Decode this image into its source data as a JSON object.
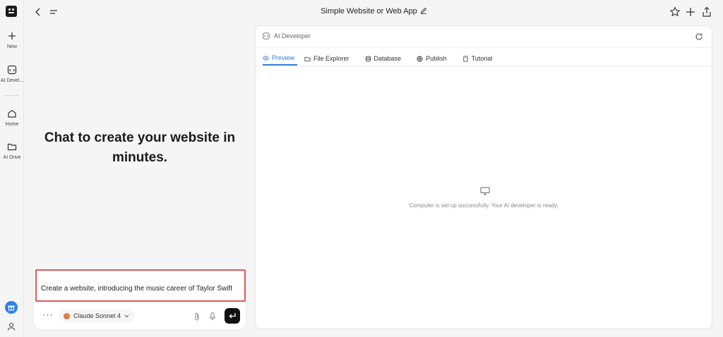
{
  "sidebar": {
    "new_label": "New",
    "ai_dev_label": "AI Devel...",
    "home_label": "Home",
    "drive_label": "AI Drive"
  },
  "header": {
    "title": "Simple Website or Web App"
  },
  "chat": {
    "hero": "Chat to create your website in minutes.",
    "prompt": "Create a website, introducing the music career of Taylor Swift",
    "more_label": "···",
    "model_label": "Claude Sonnet 4"
  },
  "panel": {
    "title": "AI Developer",
    "tabs": [
      {
        "label": "Preview",
        "icon": "eye-icon",
        "active": true
      },
      {
        "label": "File Explorer",
        "icon": "folder-icon"
      },
      {
        "label": "Database",
        "icon": "database-icon"
      },
      {
        "label": "Publish",
        "icon": "globe-icon"
      },
      {
        "label": "Tutorial",
        "icon": "book-icon"
      }
    ],
    "empty_message": "Computer is set up successfully. Your AI developer is ready."
  },
  "colors": {
    "accent": "#2f7bd8",
    "highlight_border": "#e05a5a",
    "send_button": "#111111"
  }
}
